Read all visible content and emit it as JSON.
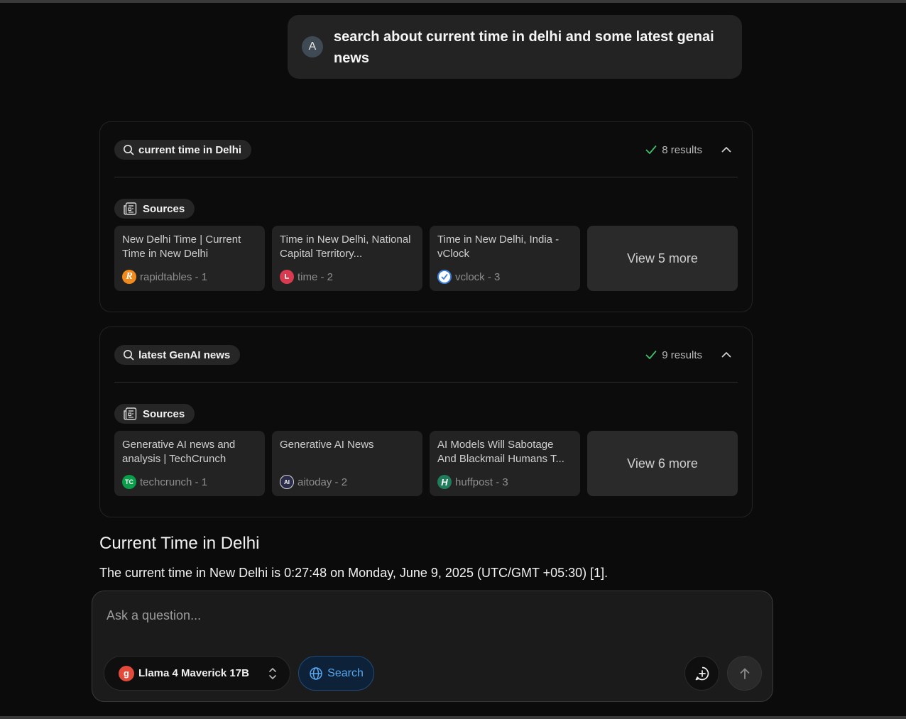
{
  "user_message": {
    "avatar_letter": "A",
    "text": "search about current time in delhi and some latest genai news"
  },
  "searches": [
    {
      "query": "current time in Delhi",
      "results_label": "8 results",
      "sources_label": "Sources",
      "sources": [
        {
          "title": "New Delhi Time | Current Time in New Delhi",
          "site": "rapidtables - 1",
          "favicon_letter": "R",
          "favicon_color": "#f08a1c"
        },
        {
          "title": "Time in New Delhi, National Capital Territory...",
          "site": "time - 2",
          "favicon_letter": "",
          "favicon_color": "#d83a4f"
        },
        {
          "title": "Time in New Delhi, India - vClock",
          "site": "vclock - 3",
          "favicon_letter": "",
          "favicon_color": "#3b7fd9"
        }
      ],
      "view_more": "View 5 more"
    },
    {
      "query": "latest GenAI news",
      "results_label": "9 results",
      "sources_label": "Sources",
      "sources": [
        {
          "title": "Generative AI news and analysis | TechCrunch",
          "site": "techcrunch - 1",
          "favicon_letter": "TC",
          "favicon_color": "#0a9e4a"
        },
        {
          "title": "Generative AI News",
          "site": "aitoday - 2",
          "favicon_letter": "AI",
          "favicon_color": "#2b2b4a"
        },
        {
          "title": "AI Models Will Sabotage And Blackmail Humans T...",
          "site": "huffpost - 3",
          "favicon_letter": "H",
          "favicon_color": "#1f7d5c"
        }
      ],
      "view_more": "View 6 more"
    }
  ],
  "answer": {
    "title": "Current Time in Delhi",
    "text": "The current time in New Delhi is 0:27:48 on Monday, June 9, 2025 (UTC/GMT +05:30) [1]."
  },
  "composer": {
    "placeholder": "Ask a question...",
    "model_logo_letter": "g",
    "model_name": "Llama 4 Maverick 17B",
    "search_label": "Search"
  },
  "colors": {
    "accent_blue": "#5aa7f0",
    "check_green": "#3fbf6a",
    "model_logo": "#e24a3b"
  }
}
